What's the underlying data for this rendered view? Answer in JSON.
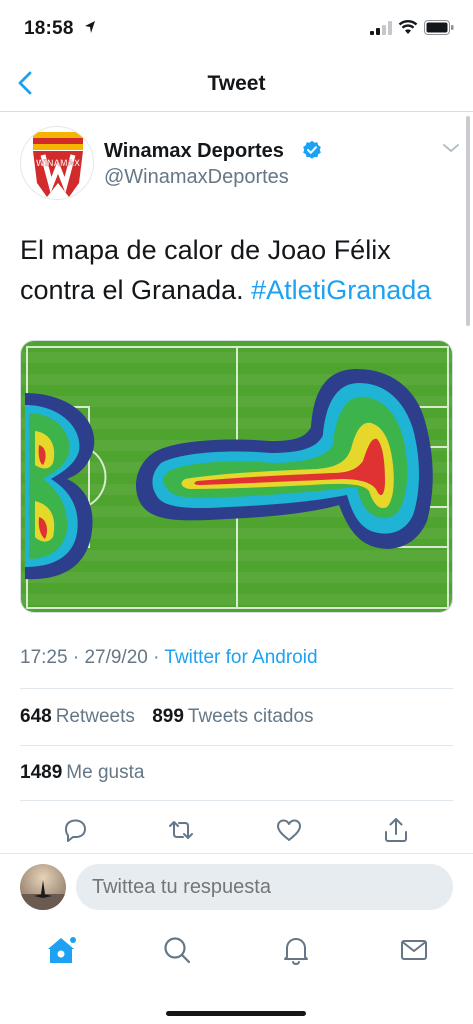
{
  "status_bar": {
    "time": "18:58"
  },
  "nav": {
    "title": "Tweet"
  },
  "tweet": {
    "display_name": "Winamax Deportes",
    "handle": "@WinamaxDeportes",
    "logo_text": "WINAMAX",
    "text": "El mapa de calor de Joao Félix contra el Granada.",
    "hashtag": "#AtletiGranada",
    "time": "17:25",
    "date": "27/9/20",
    "source": "Twitter for Android",
    "retweets_count": "648",
    "retweets_label": "Retweets",
    "quotes_count": "899",
    "quotes_label": "Tweets citados",
    "likes_count": "1489",
    "likes_label": "Me gusta"
  },
  "reply": {
    "placeholder": "Twittea tu respuesta"
  },
  "colors": {
    "accent": "#1da1f2",
    "muted": "#657786",
    "pitch": "#4aa02c"
  },
  "icons": [
    "location-arrow-icon",
    "signal-icon",
    "wifi-icon",
    "battery-icon",
    "back-chevron-icon",
    "verified-icon",
    "chevron-down-icon",
    "reply-icon",
    "retweet-icon",
    "like-icon",
    "share-icon",
    "home-icon",
    "search-icon",
    "notifications-icon",
    "messages-icon"
  ]
}
